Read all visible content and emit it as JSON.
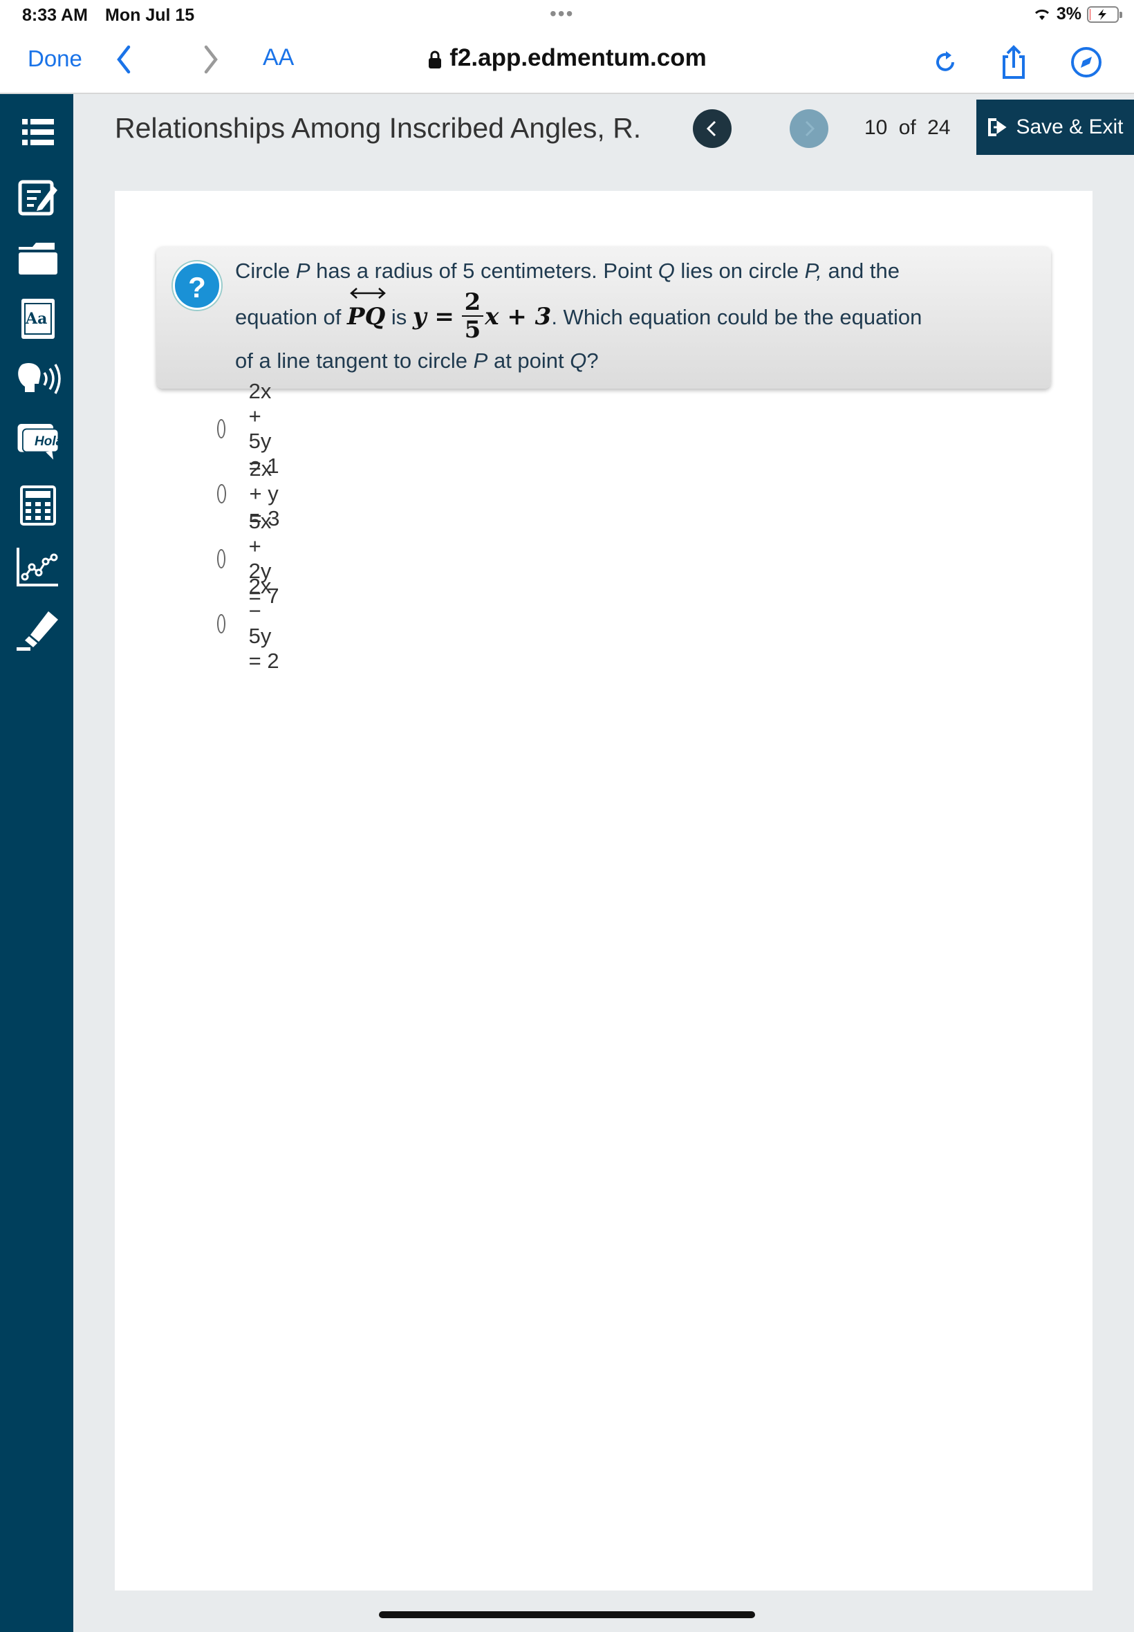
{
  "status_bar": {
    "time": "8:33 AM",
    "date": "Mon Jul 15",
    "battery": "3%",
    "battery_level": 0.03
  },
  "browser": {
    "done_label": "Done",
    "text_size_label": "AA",
    "url": "f2.app.edmentum.com"
  },
  "header": {
    "lesson_title": "Relationships Among Inscribed Angles, R.",
    "page_current": "10",
    "page_of": "of",
    "page_total": "24",
    "save_exit_label": "Save & Exit"
  },
  "rail": {
    "tools": [
      "menu-icon",
      "notes-icon",
      "folder-icon",
      "dictionary-icon",
      "text-to-speech-icon",
      "translate-icon",
      "calculator-icon",
      "graph-icon",
      "highlighter-icon"
    ],
    "translate_badge": "Hola",
    "dictionary_badge": "Aa"
  },
  "question": {
    "icon": "?",
    "line1_a": "Circle ",
    "line1_p": "P",
    "line1_b": " has a radius of 5 centimeters. Point ",
    "line1_q": "Q",
    "line1_c": " lies on circle ",
    "line1_p2": "P,",
    "line1_d": " and the",
    "line2_a": "equation of ",
    "line2_line": "PQ",
    "line2_is": " is ",
    "line2_y": "y =",
    "line2_num": "2",
    "line2_den": "5",
    "line2_rest": "x + 3",
    "line2_b": ". Which equation could be the equation",
    "line3_a": "of a line tangent to circle ",
    "line3_p": "P",
    "line3_b": " at point ",
    "line3_q": "Q",
    "line3_c": "?"
  },
  "options": [
    {
      "label": "2x + 5y = 1"
    },
    {
      "label": "2x + y = 3"
    },
    {
      "label": "5x + 2y = 7"
    },
    {
      "label": "2x − 5y = 2"
    }
  ],
  "colors": {
    "rail": "#003f5c",
    "accent": "#1a73e8",
    "save_button": "#0b3b55",
    "question_text": "#1f3a4f"
  }
}
